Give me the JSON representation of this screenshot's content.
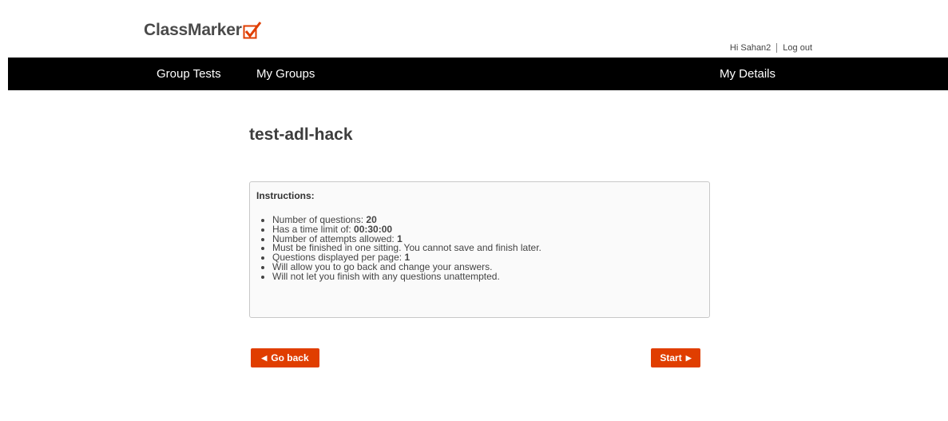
{
  "brand": {
    "name": "ClassMarker",
    "accent_color": "#e03e00",
    "logo_icon": "checkbox-check-icon"
  },
  "userbar": {
    "greeting": "Hi Sahan2",
    "logout_label": "Log out"
  },
  "nav": {
    "items": [
      {
        "label": "Group Tests"
      },
      {
        "label": "My Groups"
      }
    ],
    "right_item": {
      "label": "My Details"
    }
  },
  "test": {
    "title": "test-adl-hack"
  },
  "instructions": {
    "heading": "Instructions:",
    "items": [
      {
        "text": "Number of questions: ",
        "value": "20"
      },
      {
        "text": "Has a time limit of: ",
        "value": "00:30:00"
      },
      {
        "text": "Number of attempts allowed: ",
        "value": "1"
      },
      {
        "text": "Must be finished in one sitting. You cannot save and finish later.",
        "value": ""
      },
      {
        "text": "Questions displayed per page: ",
        "value": "1"
      },
      {
        "text": "Will allow you to go back and change your answers.",
        "value": ""
      },
      {
        "text": "Will not let you finish with any questions unattempted.",
        "value": ""
      }
    ]
  },
  "actions": {
    "back_label": "Go back",
    "back_icon": "caret-left-icon",
    "start_label": "Start",
    "start_icon": "caret-right-icon"
  }
}
